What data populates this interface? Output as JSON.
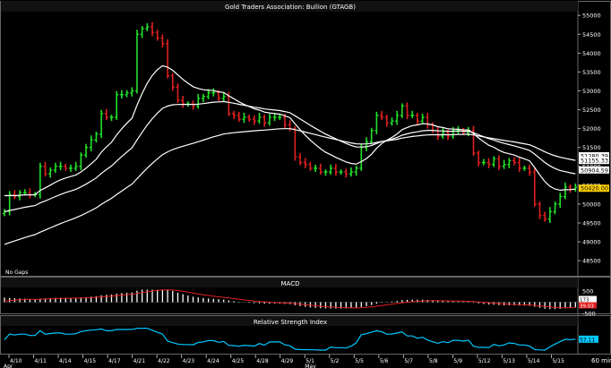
{
  "chart_data": [
    {
      "type": "ohlc",
      "title": "Gold Traders Association: Bullion (GTAGB)",
      "note": "No Gaps",
      "y_ticks": [
        48500,
        49000,
        49500,
        50000,
        50500,
        51000,
        51500,
        52000,
        52500,
        53000,
        53500,
        54000,
        54500,
        55000
      ],
      "ylim": [
        48100,
        55100
      ],
      "last_value_labels": [
        "51280.39",
        "51155.33",
        "50904.59",
        "50420.00"
      ],
      "x_tick_labels": [
        "4/10",
        "4/11",
        "4/14",
        "4/15",
        "4/17",
        "4/21",
        "4/22",
        "4/23",
        "4/24",
        "4/25",
        "4/28",
        "4/29",
        "5/1",
        "5/2",
        "5/5",
        "5/6",
        "5/7",
        "5/8",
        "5/9",
        "5/12",
        "5/13",
        "5/14",
        "5/15"
      ],
      "month_labels": [
        "Apr",
        "May"
      ],
      "close": [
        49800,
        50250,
        50200,
        50300,
        50300,
        50250,
        50250,
        51000,
        50800,
        50900,
        51000,
        51000,
        50950,
        50950,
        51000,
        51300,
        51500,
        51700,
        51850,
        52400,
        52300,
        52300,
        52900,
        52900,
        52950,
        53000,
        54500,
        54650,
        54700,
        54550,
        54400,
        54250,
        53400,
        53100,
        52750,
        52650,
        52650,
        52600,
        52800,
        52850,
        52950,
        52950,
        52800,
        52850,
        52400,
        52350,
        52250,
        52300,
        52250,
        52200,
        52300,
        52150,
        52300,
        52300,
        52300,
        52100,
        52000,
        51250,
        51100,
        51050,
        50950,
        50950,
        50850,
        50850,
        50950,
        50850,
        50850,
        50800,
        50850,
        50950,
        51500,
        51650,
        51950,
        52350,
        52300,
        52150,
        52200,
        52350,
        52600,
        52350,
        52350,
        52200,
        52300,
        52100,
        51950,
        51800,
        51900,
        51800,
        51950,
        51950,
        51900,
        51950,
        51350,
        51100,
        51100,
        51050,
        51200,
        51000,
        51050,
        51150,
        51100,
        50950,
        50950,
        50850,
        50000,
        49700,
        49600,
        49800,
        50000,
        50200,
        50450,
        50400,
        50450
      ]
    },
    {
      "type": "histogram",
      "title": "MACD",
      "y_ticks": [
        500,
        0,
        -500
      ],
      "last_value_labels": [
        "173",
        "39.03"
      ]
    },
    {
      "type": "line",
      "title": "Relative Strength Index",
      "last_value_labels": [
        "57.11"
      ],
      "timeframe": "60 min"
    }
  ]
}
